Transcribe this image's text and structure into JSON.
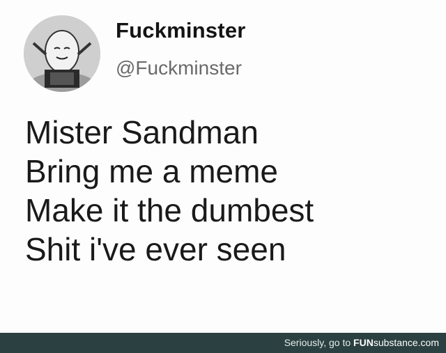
{
  "tweet": {
    "display_name": "Fuckminster",
    "handle": "@Fuckminster",
    "lines": [
      "Mister Sandman",
      "Bring me a meme",
      "Make it the dumbest",
      "Shit i've ever seen"
    ]
  },
  "footer": {
    "watermark_lead": "Seriously, go to ",
    "watermark_brand_a": "FUN",
    "watermark_brand_b": "substance",
    "watermark_tld": ".com"
  },
  "colors": {
    "footer_bg": "#2b4040",
    "text": "#1a1a1a",
    "handle": "#6a6a6a"
  },
  "icons": {
    "avatar": "egg-character-avatar-icon"
  }
}
